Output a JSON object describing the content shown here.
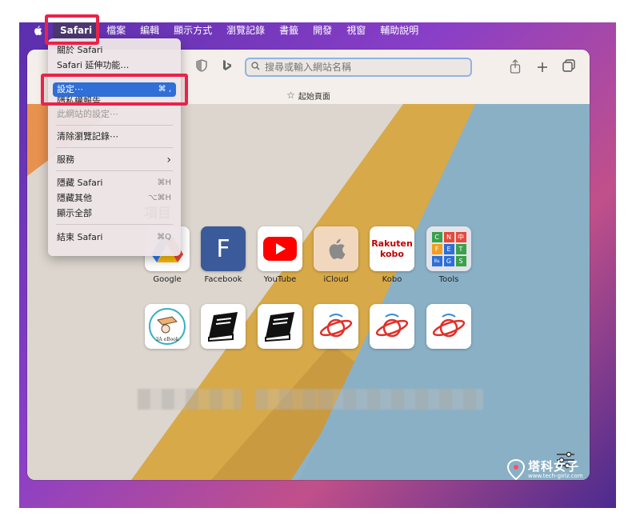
{
  "menubar": {
    "items": [
      {
        "label": "Safari"
      },
      {
        "label": "檔案"
      },
      {
        "label": "編輯"
      },
      {
        "label": "顯示方式"
      },
      {
        "label": "瀏覽記錄"
      },
      {
        "label": "書籤"
      },
      {
        "label": "開發"
      },
      {
        "label": "視窗"
      },
      {
        "label": "輔助說明"
      }
    ]
  },
  "safari_menu": {
    "items": [
      {
        "label": "關於 Safari",
        "shortcut": ""
      },
      {
        "label": "Safari 延伸功能…",
        "shortcut": ""
      },
      {
        "label": "設定⋯",
        "shortcut": "⌘ ,"
      },
      {
        "label": "隱私權報告",
        "shortcut": ""
      },
      {
        "label": "此網站的設定⋯",
        "shortcut": ""
      },
      {
        "label": "清除瀏覽記錄⋯",
        "shortcut": ""
      },
      {
        "label": "服務",
        "shortcut": "›"
      },
      {
        "label": "隱藏 Safari",
        "shortcut": "⌘H"
      },
      {
        "label": "隱藏其他",
        "shortcut": "⌥⌘H"
      },
      {
        "label": "顯示全部",
        "shortcut": ""
      },
      {
        "label": "結束 Safari",
        "shortcut": "⌘Q"
      }
    ]
  },
  "toolbar": {
    "search_placeholder": "搜尋或輸入網站名稱"
  },
  "tabbar": {
    "start_page": "起始頁面"
  },
  "favorites": {
    "title": "項目",
    "items": [
      {
        "label": "Google"
      },
      {
        "label": "Facebook",
        "glyph": "F"
      },
      {
        "label": "YouTube"
      },
      {
        "label": "iCloud"
      },
      {
        "label": "Kobo",
        "line1": "Rakuten",
        "line2": "kobo"
      },
      {
        "label": "Tools",
        "cells": [
          "C",
          "N",
          "中",
          "F",
          "E",
          "T",
          "Ilu",
          "G",
          "S"
        ]
      }
    ],
    "row2_label": "3A eBook"
  },
  "watermark": {
    "title": "塔科女子",
    "url": "www.tech-girlz.com"
  },
  "colors": {
    "accent": "#2f6fd6",
    "highlight": "#e8234a",
    "facebook": "#3b5a9a",
    "youtube": "#ff0000",
    "kobo": "#bf0000"
  }
}
